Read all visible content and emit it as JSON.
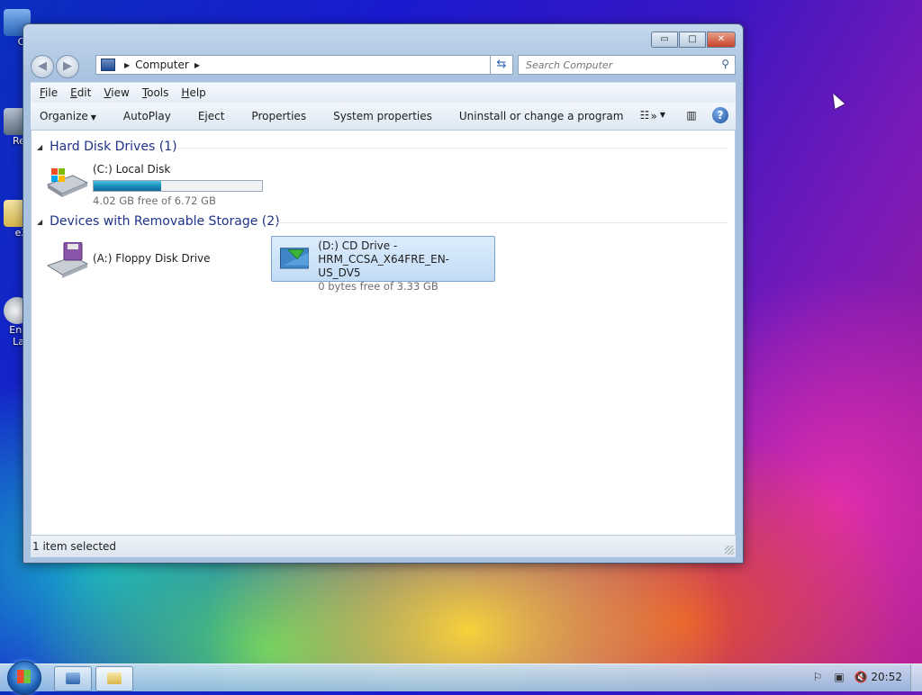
{
  "desktop": {
    "icons": [
      {
        "label": "Co",
        "color": "#3a7bd5"
      },
      {
        "label": "Rec",
        "color": "#5c6d80"
      },
      {
        "label": "eXi",
        "color": "#e3c96a"
      },
      {
        "label": "Enal",
        "label2": "Lau",
        "color": "#c9ced4"
      }
    ]
  },
  "window": {
    "caption_buttons": {
      "minimize": "▭",
      "maximize": "□",
      "close": "✕"
    },
    "nav": {
      "back_icon": "back-arrow-icon",
      "forward_icon": "forward-arrow-icon"
    },
    "address": {
      "crumb": "Computer"
    },
    "search": {
      "placeholder": "Search Computer"
    },
    "menu": [
      "File",
      "Edit",
      "View",
      "Tools",
      "Help"
    ],
    "commands": {
      "organize": "Organize",
      "autoplay": "AutoPlay",
      "eject": "Eject",
      "properties": "Properties",
      "system_properties": "System properties",
      "uninstall": "Uninstall or change a program",
      "more": "»"
    },
    "groups": {
      "hdd": {
        "title": "Hard Disk Drives (1)",
        "items": [
          {
            "name": "(C:) Local Disk",
            "free": "4.02 GB free of 6.72 GB",
            "used_fraction": 0.4
          }
        ]
      },
      "removable": {
        "title": "Devices with Removable Storage (2)",
        "items": [
          {
            "name": "(A:) Floppy Disk Drive"
          },
          {
            "name": "(D:) CD Drive -",
            "name2": "HRM_CCSA_X64FRE_EN-US_DV5",
            "free": "0 bytes free of 3.33 GB",
            "selected": true
          }
        ]
      }
    },
    "status": "1 item selected"
  },
  "taskbar": {
    "clock": "20:52"
  },
  "colors": {
    "accent": "#1e3287",
    "selection": "#c3dcf5"
  }
}
